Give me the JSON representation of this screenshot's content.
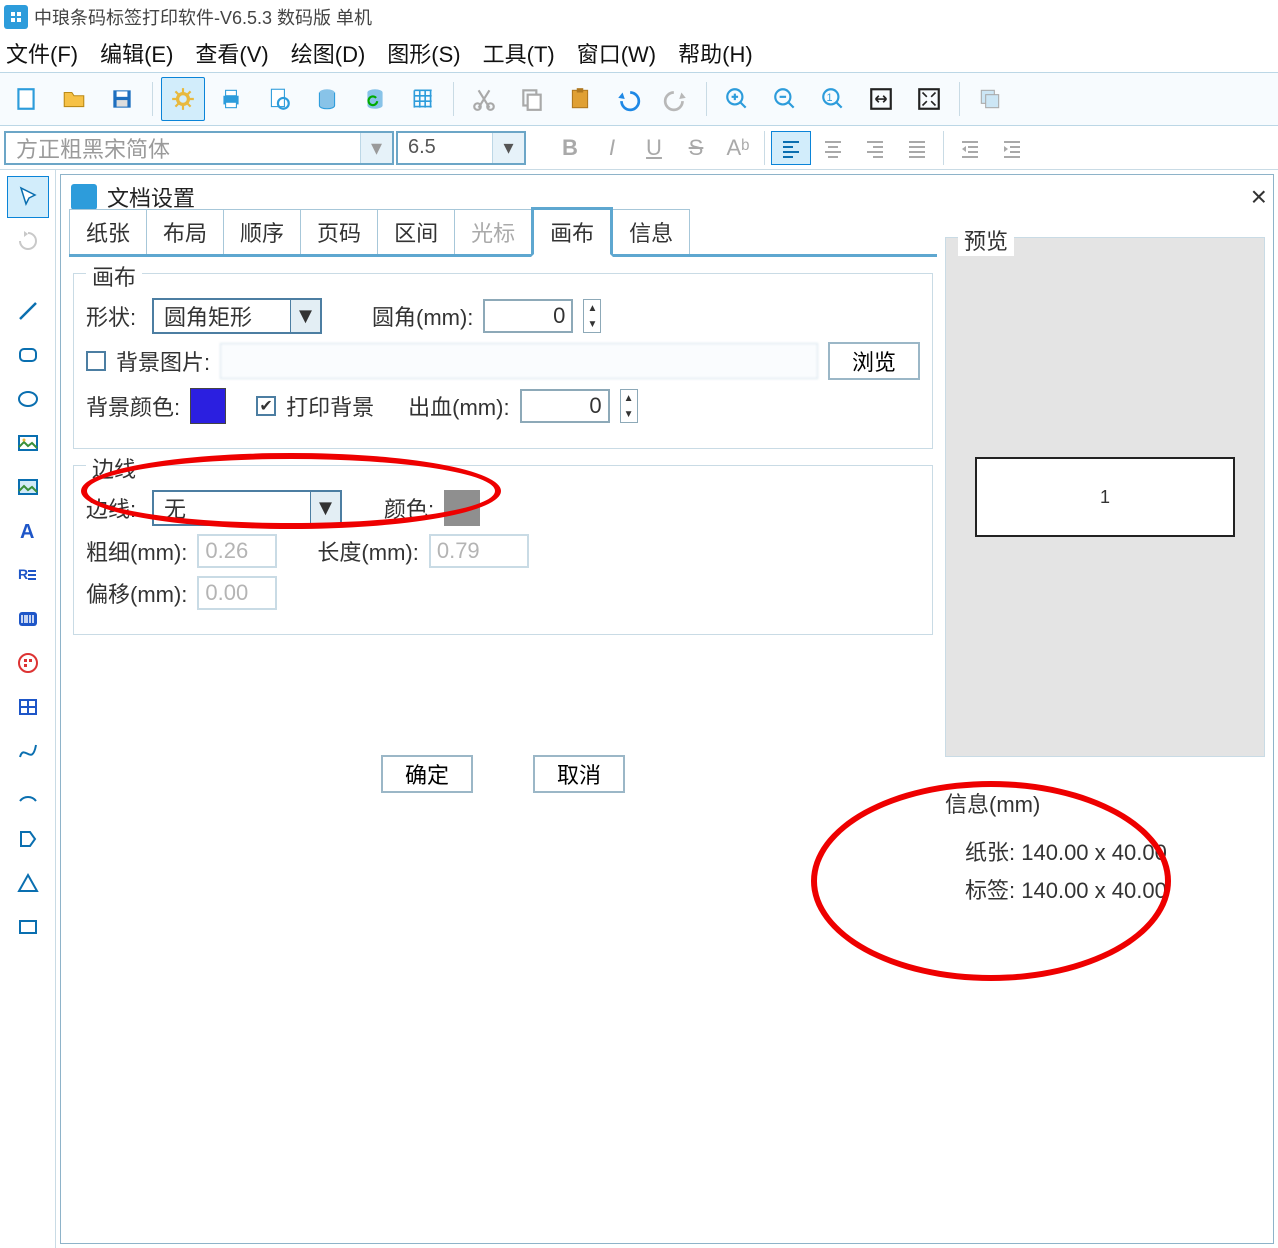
{
  "app": {
    "title": "中琅条码标签打印软件-V6.5.3 数码版 单机"
  },
  "menu": {
    "file": "文件(F)",
    "edit": "编辑(E)",
    "view": "查看(V)",
    "draw": "绘图(D)",
    "shape": "图形(S)",
    "tool": "工具(T)",
    "window": "窗口(W)",
    "help": "帮助(H)"
  },
  "font": {
    "name": "方正粗黑宋简体",
    "size": "6.5"
  },
  "dialog": {
    "title": "文档设置",
    "tabs": {
      "paper": "纸张",
      "layout": "布局",
      "order": "顺序",
      "page": "页码",
      "range": "区间",
      "cursor": "光标",
      "canvas": "画布",
      "info": "信息"
    },
    "canvas_group": {
      "legend": "画布",
      "shape_label": "形状:",
      "shape_value": "圆角矩形",
      "corner_label": "圆角(mm):",
      "corner_value": "0",
      "bgimg_label": "背景图片:",
      "bgimg_checked": false,
      "browse": "浏览",
      "bgcolor_label": "背景颜色:",
      "bgcolor_value": "#2b1fe0",
      "print_bg_label": "打印背景",
      "print_bg_checked": true,
      "bleed_label": "出血(mm):",
      "bleed_value": "0"
    },
    "border_group": {
      "legend": "边线",
      "border_label": "边线:",
      "border_value": "无",
      "color_label": "颜色:",
      "color_value": "#8f8f8f",
      "thick_label": "粗细(mm):",
      "thick_value": "0.26",
      "length_label": "长度(mm):",
      "length_value": "0.79",
      "offset_label": "偏移(mm):",
      "offset_value": "0.00"
    },
    "preview": {
      "legend": "预览",
      "label_text": "1"
    },
    "info": {
      "title": "信息(mm)",
      "paper_label": "纸张:",
      "paper_value": "140.00 x 40.00",
      "label_label": "标签:",
      "label_value": "140.00 x 40.00"
    },
    "footer": {
      "ok": "确定",
      "cancel": "取消"
    }
  }
}
